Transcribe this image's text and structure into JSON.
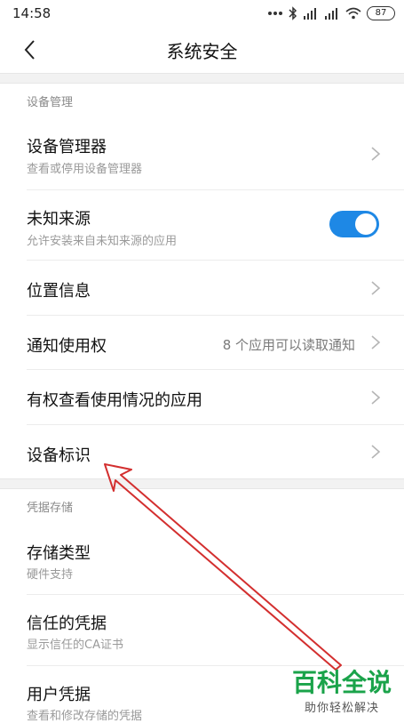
{
  "status_bar": {
    "time": "14:58",
    "battery": "87"
  },
  "header": {
    "title": "系统安全"
  },
  "sections": [
    {
      "header": "设备管理",
      "items": [
        {
          "title": "设备管理器",
          "subtitle": "查看或停用设备管理器"
        },
        {
          "title": "未知来源",
          "subtitle": "允许安装来自未知来源的应用",
          "toggle_on": true
        },
        {
          "title": "位置信息"
        },
        {
          "title": "通知使用权",
          "value": "8 个应用可以读取通知"
        },
        {
          "title": "有权查看使用情况的应用"
        },
        {
          "title": "设备标识"
        }
      ]
    },
    {
      "header": "凭据存储",
      "items": [
        {
          "title": "存储类型",
          "subtitle": "硬件支持"
        },
        {
          "title": "信任的凭据",
          "subtitle": "显示信任的CA证书"
        },
        {
          "title": "用户凭据",
          "subtitle": "查看和修改存储的凭据"
        }
      ]
    }
  ],
  "watermark": {
    "title": "百科全说",
    "subtitle": "助你轻松解决"
  },
  "colors": {
    "toggle_on": "#1e88e5",
    "annotation_arrow": "#d32f2f",
    "watermark_green": "#1aa34a"
  }
}
